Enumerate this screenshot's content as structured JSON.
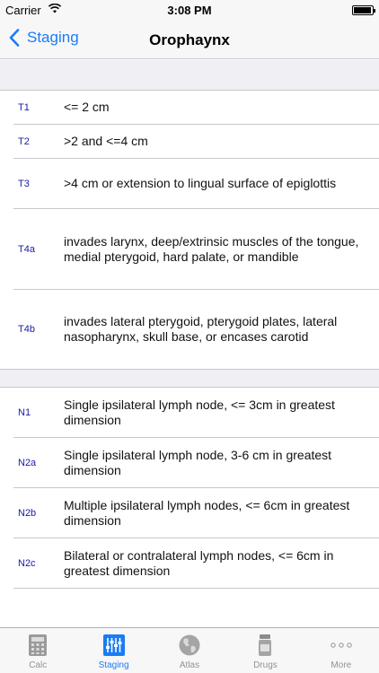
{
  "status_bar": {
    "carrier": "Carrier",
    "time": "3:08 PM"
  },
  "nav": {
    "back_label": "Staging",
    "title": "Orophaynx"
  },
  "t_rows": [
    {
      "code": "T1",
      "description": "<= 2 cm"
    },
    {
      "code": "T2",
      "description": ">2 and <=4 cm"
    },
    {
      "code": "T3",
      "description": ">4 cm or extension to lingual surface of epiglottis"
    },
    {
      "code": "T4a",
      "description": "invades larynx, deep/extrinsic muscles of the tongue, medial pterygoid, hard palate, or mandible"
    },
    {
      "code": "T4b",
      "description": "invades lateral pterygoid, pterygoid plates, lateral nasopharynx, skull base, or encases carotid"
    }
  ],
  "n_rows": [
    {
      "code": "N1",
      "description": "Single ipsilateral lymph node, <= 3cm in greatest dimension"
    },
    {
      "code": "N2a",
      "description": "Single ipsilateral lymph node, 3-6 cm in greatest dimension"
    },
    {
      "code": "N2b",
      "description": "Multiple ipsilateral lymph nodes, <= 6cm in greatest dimension"
    },
    {
      "code": "N2c",
      "description": "Bilateral or contralateral lymph nodes, <= 6cm in greatest dimension"
    }
  ],
  "tabs": [
    {
      "label": "Calc",
      "icon": "calculator-icon"
    },
    {
      "label": "Staging",
      "icon": "sliders-icon"
    },
    {
      "label": "Atlas",
      "icon": "globe-icon"
    },
    {
      "label": "Drugs",
      "icon": "pill-bottle-icon"
    },
    {
      "label": "More",
      "icon": "more-dots-icon"
    }
  ],
  "colors": {
    "accent": "#1a7cf5",
    "code_text": "#1a1aa8",
    "group_background": "#efeff4",
    "separator": "#c8c7cc"
  }
}
